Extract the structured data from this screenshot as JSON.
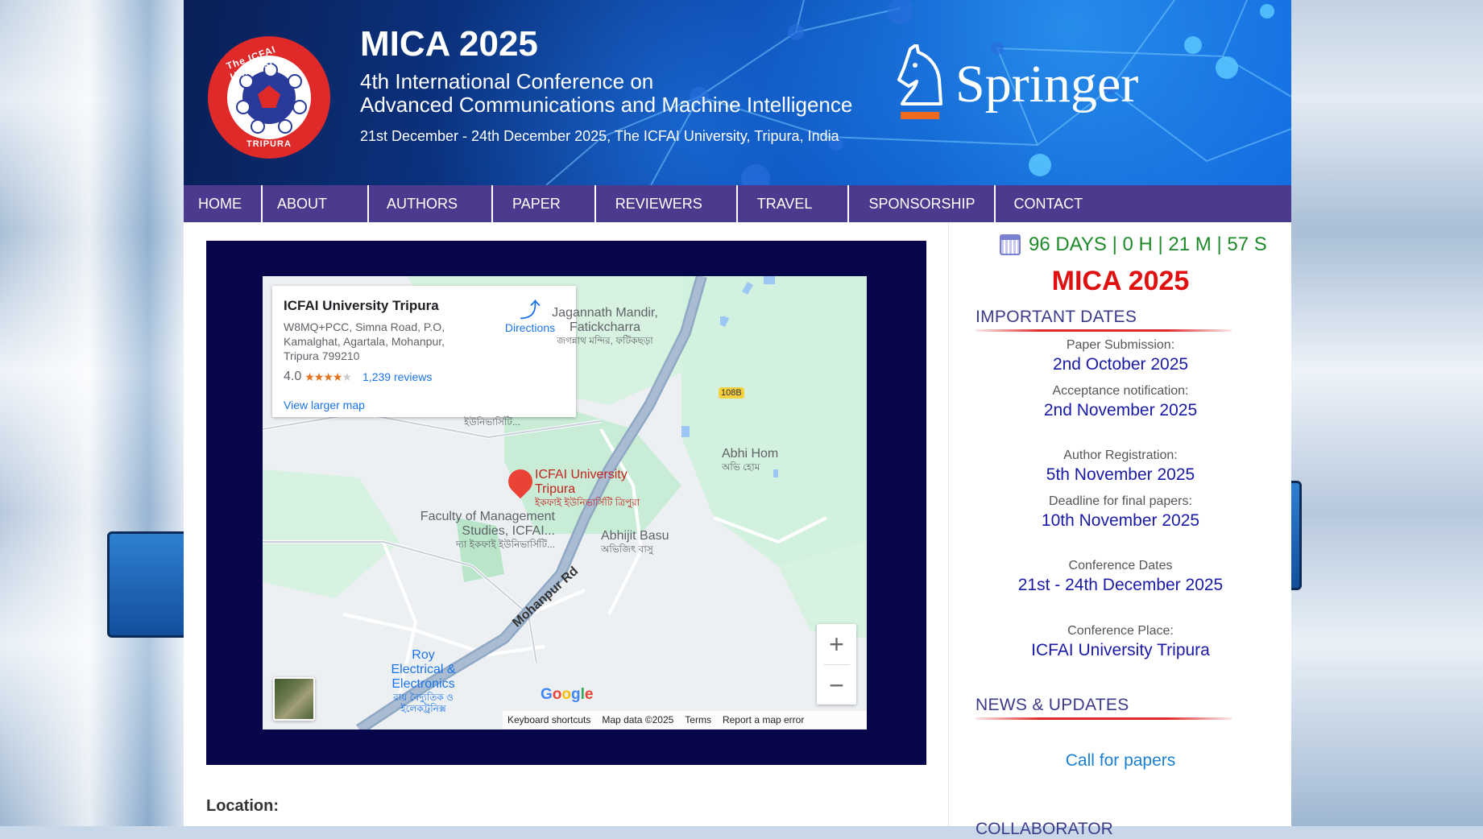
{
  "header": {
    "logo_text_top": "The ICFAI University",
    "logo_text_bottom": "TRIPURA",
    "title": "MICA 2025",
    "subtitle_line1": "4th International Conference on",
    "subtitle_line2": "Advanced Communications and Machine Intelligence",
    "date_line": "21st December - 24th December 2025, The ICFAI University, Tripura, India",
    "publisher": "Springer"
  },
  "nav": {
    "items": [
      "HOME",
      "ABOUT",
      "AUTHORS",
      "PAPER",
      "REVIEWERS",
      "TRAVEL",
      "SPONSORSHIP",
      "CONTACT"
    ]
  },
  "map": {
    "place_name": "ICFAI University Tripura",
    "address": "W8MQ+PCC, Simna Road, P.O, Kamalghat, Agartala, Mohanpur, Tripura 799210",
    "rating": "4.0",
    "stars": 4,
    "reviews": "1,239 reviews",
    "view_larger": "View larger map",
    "directions": "Directions",
    "labels": {
      "jagannath": "Jagannath Mandir, Fatickcharra",
      "jagannath_bn": "জগন্নাথ মন্দির, ফটিকছড়া",
      "road_badge": "108B",
      "abhi_home": "Abhi Hom",
      "abhi_home_bn": "অভি হোম",
      "pin_label": "ICFAI University Tripura",
      "pin_label_bn": "ইকফাই ইউনিভার্সিটি ত্রিপুরা",
      "faculty": "Faculty of Management Studies, ICFAI...",
      "faculty_bn": "দ্যা ইকফাই ইউনিভার্সিটি...",
      "abhijit": "Abhijit Basu",
      "abhijit_bn": "অভিজিৎ বাসু",
      "roy": "Roy Electrical & Electronics",
      "roy_bn": "রায় বৈদ্যুতিক ও ইলেকট্রনিক্স",
      "road": "Mohanpur Rd",
      "hidden_label_bn": "ইউনিভার্সিটি..."
    },
    "zoom_in": "+",
    "zoom_out": "−",
    "google": "Google",
    "attribution": [
      "Keyboard shortcuts",
      "Map data ©2025",
      "Terms",
      "Report a map error"
    ]
  },
  "content": {
    "location_label": "Location:"
  },
  "sidebar": {
    "countdown": "96 DAYS | 0 H | 21 M | 57 S",
    "mica": "MICA 2025",
    "important_dates_heading": "IMPORTANT DATES",
    "dates": [
      {
        "label": "Paper Submission:",
        "value": "2nd October 2025"
      },
      {
        "label": "Acceptance notification:",
        "value": "2nd November 2025"
      },
      {
        "label": "Author Registration:",
        "value": "5th November 2025"
      },
      {
        "label": "Deadline for final papers:",
        "value": "10th November 2025"
      },
      {
        "label": "Conference Dates",
        "value": "21st - 24th December 2025"
      },
      {
        "label": "Conference Place:",
        "value": "ICFAI University Tripura"
      }
    ],
    "news_heading": "NEWS & UPDATES",
    "news_link": "Call for papers",
    "collaborator_heading": "COLLABORATOR"
  },
  "colors": {
    "nav_bg": "#4b3a8e",
    "map_frame": "#08064a",
    "accent_red": "#e01010",
    "date_blue": "#1a1aa8",
    "countdown_green": "#1e8a2a"
  }
}
